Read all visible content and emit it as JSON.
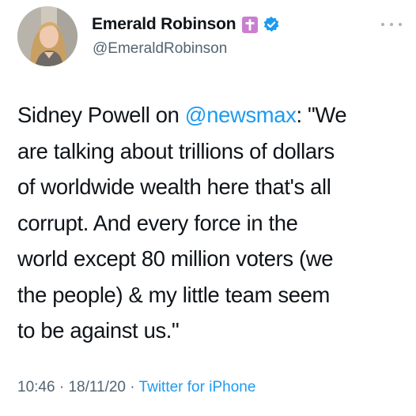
{
  "author": {
    "display_name": "Emerald Robinson",
    "handle": "@EmeraldRobinson",
    "badges": [
      "cross-badge",
      "verified-badge"
    ],
    "avatar_icon": "profile-photo"
  },
  "tweet": {
    "lines": [
      {
        "before": "Sidney Powell on ",
        "mention": "@newsmax",
        "after": ": \"We"
      },
      {
        "text": "are talking about trillions of dollars"
      },
      {
        "text": "of worldwide wealth here that's all"
      },
      {
        "text": "corrupt. And every force in the"
      },
      {
        "text": "world except 80 million voters (we"
      },
      {
        "text": "the people) & my little team seem"
      },
      {
        "text": "to be against us.\""
      }
    ]
  },
  "meta": {
    "time": "10:46",
    "date": "18/11/20",
    "separator": " · ",
    "source": "Twitter for iPhone"
  },
  "colors": {
    "text": "#0f1419",
    "secondary": "#536471",
    "link": "#1d9bf0",
    "cross_badge": "#c97fd0",
    "verified": "#1d9bf0"
  }
}
